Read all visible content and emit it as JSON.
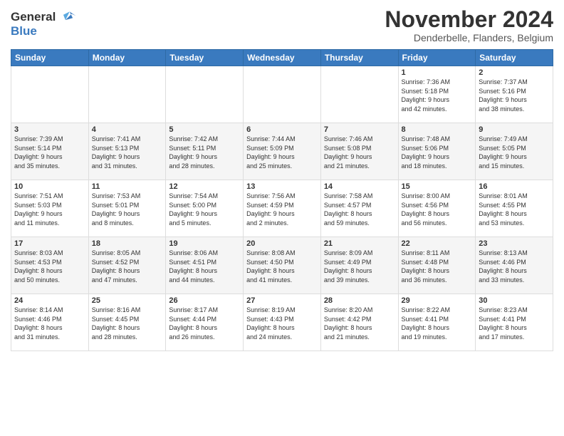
{
  "header": {
    "logo_line1": "General",
    "logo_line2": "Blue",
    "month": "November 2024",
    "location": "Denderbelle, Flanders, Belgium"
  },
  "days_of_week": [
    "Sunday",
    "Monday",
    "Tuesday",
    "Wednesday",
    "Thursday",
    "Friday",
    "Saturday"
  ],
  "weeks": [
    [
      {
        "day": "",
        "info": ""
      },
      {
        "day": "",
        "info": ""
      },
      {
        "day": "",
        "info": ""
      },
      {
        "day": "",
        "info": ""
      },
      {
        "day": "",
        "info": ""
      },
      {
        "day": "1",
        "info": "Sunrise: 7:36 AM\nSunset: 5:18 PM\nDaylight: 9 hours\nand 42 minutes."
      },
      {
        "day": "2",
        "info": "Sunrise: 7:37 AM\nSunset: 5:16 PM\nDaylight: 9 hours\nand 38 minutes."
      }
    ],
    [
      {
        "day": "3",
        "info": "Sunrise: 7:39 AM\nSunset: 5:14 PM\nDaylight: 9 hours\nand 35 minutes."
      },
      {
        "day": "4",
        "info": "Sunrise: 7:41 AM\nSunset: 5:13 PM\nDaylight: 9 hours\nand 31 minutes."
      },
      {
        "day": "5",
        "info": "Sunrise: 7:42 AM\nSunset: 5:11 PM\nDaylight: 9 hours\nand 28 minutes."
      },
      {
        "day": "6",
        "info": "Sunrise: 7:44 AM\nSunset: 5:09 PM\nDaylight: 9 hours\nand 25 minutes."
      },
      {
        "day": "7",
        "info": "Sunrise: 7:46 AM\nSunset: 5:08 PM\nDaylight: 9 hours\nand 21 minutes."
      },
      {
        "day": "8",
        "info": "Sunrise: 7:48 AM\nSunset: 5:06 PM\nDaylight: 9 hours\nand 18 minutes."
      },
      {
        "day": "9",
        "info": "Sunrise: 7:49 AM\nSunset: 5:05 PM\nDaylight: 9 hours\nand 15 minutes."
      }
    ],
    [
      {
        "day": "10",
        "info": "Sunrise: 7:51 AM\nSunset: 5:03 PM\nDaylight: 9 hours\nand 11 minutes."
      },
      {
        "day": "11",
        "info": "Sunrise: 7:53 AM\nSunset: 5:01 PM\nDaylight: 9 hours\nand 8 minutes."
      },
      {
        "day": "12",
        "info": "Sunrise: 7:54 AM\nSunset: 5:00 PM\nDaylight: 9 hours\nand 5 minutes."
      },
      {
        "day": "13",
        "info": "Sunrise: 7:56 AM\nSunset: 4:59 PM\nDaylight: 9 hours\nand 2 minutes."
      },
      {
        "day": "14",
        "info": "Sunrise: 7:58 AM\nSunset: 4:57 PM\nDaylight: 8 hours\nand 59 minutes."
      },
      {
        "day": "15",
        "info": "Sunrise: 8:00 AM\nSunset: 4:56 PM\nDaylight: 8 hours\nand 56 minutes."
      },
      {
        "day": "16",
        "info": "Sunrise: 8:01 AM\nSunset: 4:55 PM\nDaylight: 8 hours\nand 53 minutes."
      }
    ],
    [
      {
        "day": "17",
        "info": "Sunrise: 8:03 AM\nSunset: 4:53 PM\nDaylight: 8 hours\nand 50 minutes."
      },
      {
        "day": "18",
        "info": "Sunrise: 8:05 AM\nSunset: 4:52 PM\nDaylight: 8 hours\nand 47 minutes."
      },
      {
        "day": "19",
        "info": "Sunrise: 8:06 AM\nSunset: 4:51 PM\nDaylight: 8 hours\nand 44 minutes."
      },
      {
        "day": "20",
        "info": "Sunrise: 8:08 AM\nSunset: 4:50 PM\nDaylight: 8 hours\nand 41 minutes."
      },
      {
        "day": "21",
        "info": "Sunrise: 8:09 AM\nSunset: 4:49 PM\nDaylight: 8 hours\nand 39 minutes."
      },
      {
        "day": "22",
        "info": "Sunrise: 8:11 AM\nSunset: 4:48 PM\nDaylight: 8 hours\nand 36 minutes."
      },
      {
        "day": "23",
        "info": "Sunrise: 8:13 AM\nSunset: 4:46 PM\nDaylight: 8 hours\nand 33 minutes."
      }
    ],
    [
      {
        "day": "24",
        "info": "Sunrise: 8:14 AM\nSunset: 4:46 PM\nDaylight: 8 hours\nand 31 minutes."
      },
      {
        "day": "25",
        "info": "Sunrise: 8:16 AM\nSunset: 4:45 PM\nDaylight: 8 hours\nand 28 minutes."
      },
      {
        "day": "26",
        "info": "Sunrise: 8:17 AM\nSunset: 4:44 PM\nDaylight: 8 hours\nand 26 minutes."
      },
      {
        "day": "27",
        "info": "Sunrise: 8:19 AM\nSunset: 4:43 PM\nDaylight: 8 hours\nand 24 minutes."
      },
      {
        "day": "28",
        "info": "Sunrise: 8:20 AM\nSunset: 4:42 PM\nDaylight: 8 hours\nand 21 minutes."
      },
      {
        "day": "29",
        "info": "Sunrise: 8:22 AM\nSunset: 4:41 PM\nDaylight: 8 hours\nand 19 minutes."
      },
      {
        "day": "30",
        "info": "Sunrise: 8:23 AM\nSunset: 4:41 PM\nDaylight: 8 hours\nand 17 minutes."
      }
    ]
  ]
}
